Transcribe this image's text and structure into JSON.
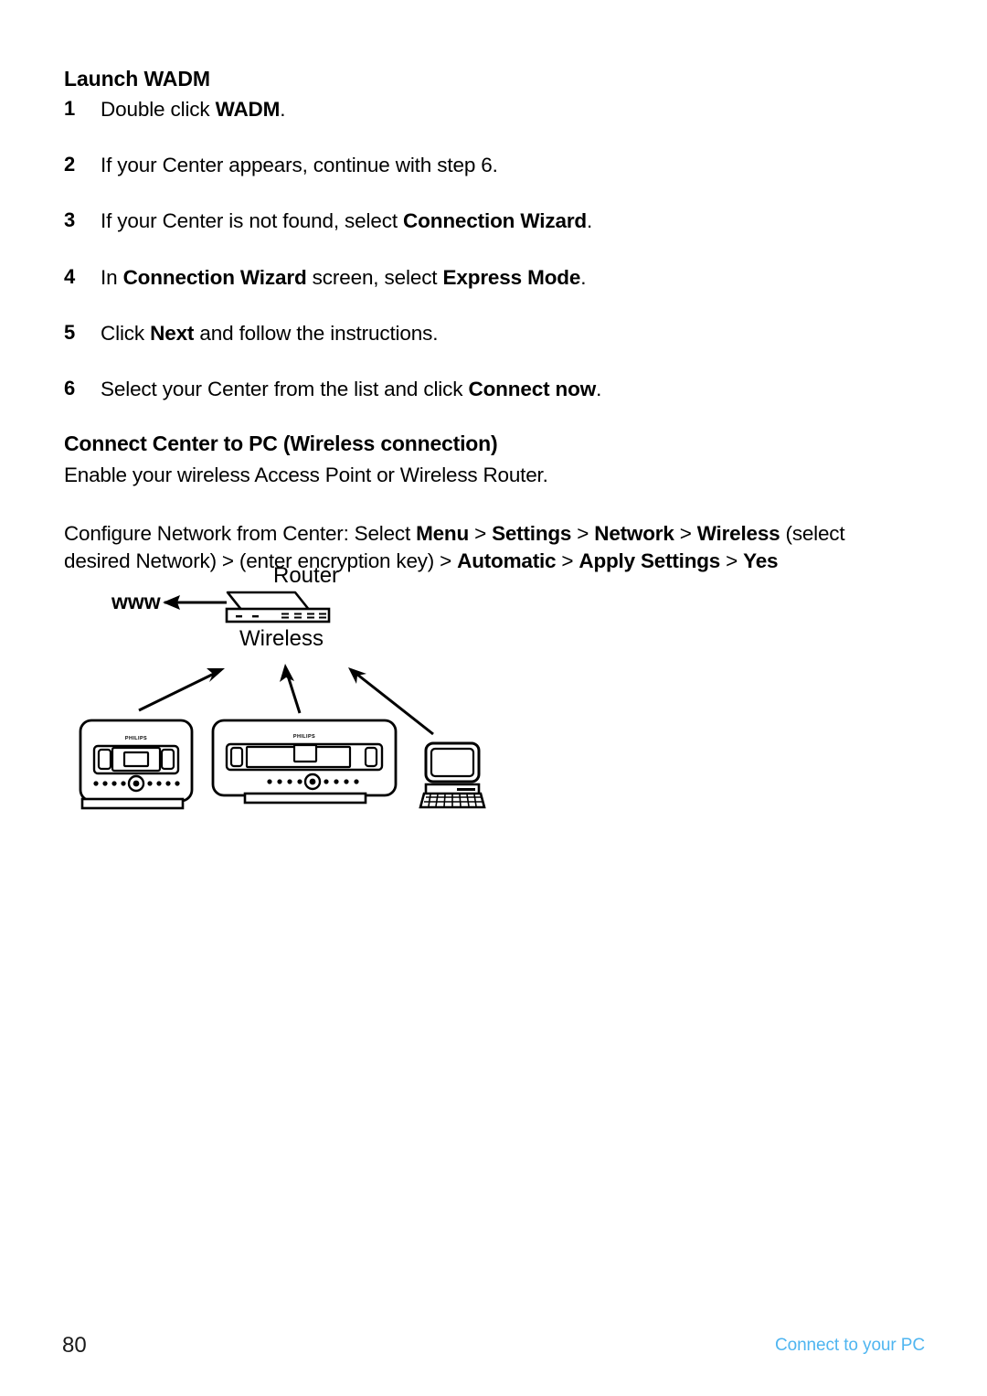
{
  "document": {
    "section_title": "Launch WADM",
    "steps": [
      {
        "num": "1",
        "text_html": "Double click <b>WADM</b>."
      },
      {
        "num": "2",
        "text_html": "If your Center appears, continue with step 6."
      },
      {
        "num": "3",
        "text_html": "If your Center is not found, select <b>Connection Wizard</b>."
      },
      {
        "num": "4",
        "text_html": "In <b>Connection Wizard</b> screen, select <b>Express Mode</b>."
      },
      {
        "num": "5",
        "text_html": "Click <b>Next</b> and follow the instructions."
      },
      {
        "num": "6",
        "text_html": "Select your Center from the list and click <b>Connect now</b>."
      }
    ],
    "subsection": {
      "heading": "Connect Center to PC (Wireless connection)",
      "body": "Enable your wireless Access Point or Wireless Router.",
      "config_html": "Configure Network from Center: Select <b>Menu</b> &gt; <b>Settings</b> &gt; <b>Network</b> &gt; <b>Wireless</b> (select desired Network) &gt; (enter encryption key) &gt; <b>Automatic</b> &gt; <b>Apply Settings</b> &gt; <b>Yes</b>"
    }
  },
  "diagram": {
    "labels": {
      "router": "Router",
      "wireless": "Wireless",
      "www": "www"
    },
    "devices": {
      "station_brand": "PHILIPS",
      "center_brand": "PHILIPS"
    },
    "colors": {
      "stroke": "#000000",
      "fill": "#ffffff"
    }
  },
  "footer": {
    "page_number": "80",
    "label": "Connect to your PC",
    "label_color": "#4FB5F0"
  }
}
